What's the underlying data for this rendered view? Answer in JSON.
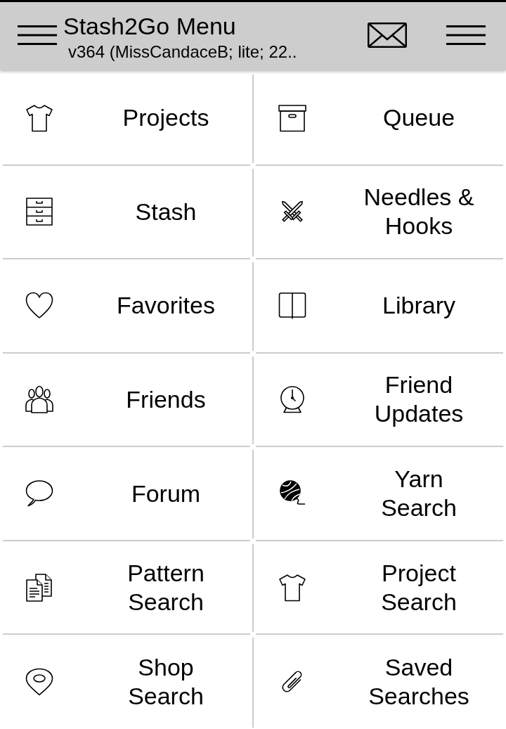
{
  "header": {
    "title": "Stash2Go Menu",
    "subtitle": "v364 (MissCandaceB; lite; 22.."
  },
  "menu_rows": [
    {
      "items": [
        {
          "label": "Projects"
        },
        {
          "label": "Queue"
        }
      ]
    },
    {
      "items": [
        {
          "label": "Stash"
        },
        {
          "label": "Needles & Hooks"
        }
      ]
    },
    {
      "items": [
        {
          "label": "Favorites"
        },
        {
          "label": "Library"
        }
      ]
    },
    {
      "items": [
        {
          "label": "Friends"
        },
        {
          "label": "Friend Updates"
        }
      ]
    },
    {
      "items": [
        {
          "label": "Forum"
        },
        {
          "label": "Yarn Search"
        }
      ]
    },
    {
      "items": [
        {
          "label": "Pattern Search"
        },
        {
          "label": "Project Search"
        }
      ]
    },
    {
      "items": [
        {
          "label": "Shop Search"
        },
        {
          "label": "Saved Searches"
        }
      ]
    }
  ]
}
